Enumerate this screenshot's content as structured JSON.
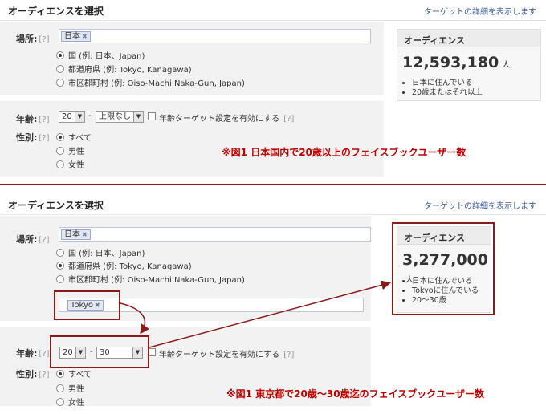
{
  "panel1": {
    "title": "オーディエンスを選択",
    "link": "ターゲットの詳細を表示します",
    "location_label": "場所:",
    "help": "[?]",
    "location_token": "日本",
    "location_options": [
      "国 (例: 日本、Japan)",
      "都道府県 (例: Tokyo, Kanagawa)",
      "市区郡町村 (例: Oiso-Machi Naka-Gun, Japan)"
    ],
    "age_label": "年齢:",
    "age_min": "20",
    "age_max": "上限なし",
    "age_check_label": "年齢ターゲット設定を有効にする",
    "gender_label": "性別:",
    "gender_options": [
      "すべて",
      "男性",
      "女性"
    ],
    "audience_title": "オーディエンス",
    "audience_count": "12,593,180",
    "audience_unit": "人",
    "audience_items": [
      "日本に住んでいる",
      "20歳またはそれ以上"
    ],
    "note": "※図1 日本国内で20歳以上のフェイスブックユーザー数"
  },
  "panel2": {
    "title": "オーディエンスを選択",
    "link": "ターゲットの詳細を表示します",
    "location_label": "場所:",
    "help": "[?]",
    "location_token": "日本",
    "location_options": [
      "国 (例: 日本、Japan)",
      "都道府県 (例: Tokyo, Kanagawa)",
      "市区郡町村 (例: Oiso-Machi Naka-Gun, Japan)"
    ],
    "region_token": "Tokyo",
    "age_label": "年齢:",
    "age_min": "20",
    "age_max": "30",
    "age_check_label": "年齢ターゲット設定を有効にする",
    "gender_label": "性別:",
    "gender_options": [
      "すべて",
      "男性",
      "女性"
    ],
    "audience_title": "オーディエンス",
    "audience_count": "3,277,000",
    "audience_unit": "人",
    "audience_items": [
      "日本に住んでいる",
      "Tokyoに住んでいる",
      "20〜30歳"
    ],
    "note": "※図1 東京都で20歳〜30歳迄のフェイスブックユーザー数"
  },
  "colors": {
    "annotation": "#8b1a1a",
    "note_text": "#c00000",
    "link": "#3b5998"
  }
}
